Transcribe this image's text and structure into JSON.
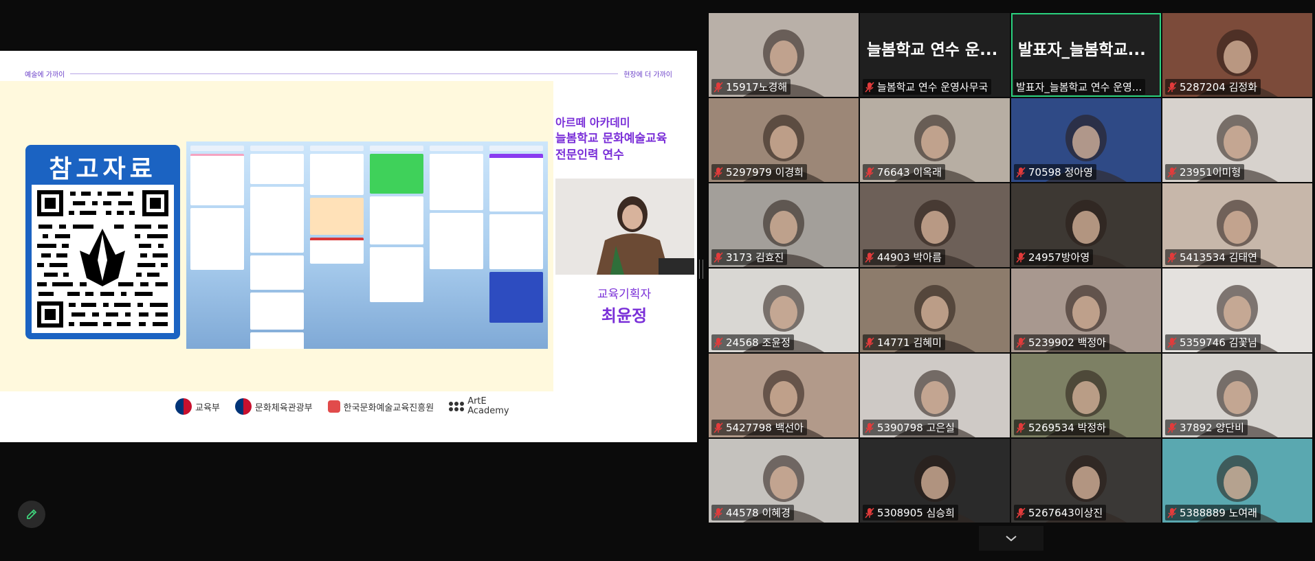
{
  "slide": {
    "top_left": "예술에 가까이",
    "top_right": "현장에 더 가까이",
    "qr_title": "참고자료",
    "sub_title": "아르떼 아카데미",
    "heading_line1": "늘봄학교 문화예술교육",
    "heading_line2": "전문인력 연수",
    "speaker_role": "교육기획자",
    "speaker_name": "최윤정",
    "logos": [
      "교육부",
      "문화체육관광부",
      "한국문화예술교육진흥원",
      "ArtE Academy"
    ]
  },
  "gallery": [
    {
      "name": "15917노경해",
      "bg": "#b9b0a8",
      "muted": true
    },
    {
      "name": "늘봄학교 연수 운영사무국",
      "big": "늘봄학교 연수 운...",
      "bg": "#1f1f1f",
      "muted": true
    },
    {
      "name": "발표자_늘봄학교 연수 운영...",
      "big": "발표자_늘봄학교...",
      "bg": "#1f1f1f",
      "muted": false,
      "active": true
    },
    {
      "name": "5287204 김정화",
      "bg": "#7c4b3a",
      "muted": true
    },
    {
      "name": "5297979 이경희",
      "bg": "#9c8777",
      "muted": true
    },
    {
      "name": "76643 이옥래",
      "bg": "#b7aea3",
      "muted": true
    },
    {
      "name": "70598 정아영",
      "bg": "#2f4a86",
      "muted": true
    },
    {
      "name": "23951이미형",
      "bg": "#d7d2cd",
      "muted": true
    },
    {
      "name": "3173 김효진",
      "bg": "#a39f9a",
      "muted": true
    },
    {
      "name": "44903 박아름",
      "bg": "#6d6058",
      "muted": true
    },
    {
      "name": "24957방아영",
      "bg": "#3d3833",
      "muted": true
    },
    {
      "name": "5413534 김태연",
      "bg": "#c7b7aa",
      "muted": true
    },
    {
      "name": "24568 조윤정",
      "bg": "#d9d7d3",
      "muted": true
    },
    {
      "name": "14771 김혜미",
      "bg": "#8d7c6c",
      "muted": true
    },
    {
      "name": "5239902 백정아",
      "bg": "#a8988f",
      "muted": true
    },
    {
      "name": "5359746 김꽃님",
      "bg": "#e4e1de",
      "muted": true
    },
    {
      "name": "5427798 백선아",
      "bg": "#b29a8a",
      "muted": true
    },
    {
      "name": "5390798 고은실",
      "bg": "#cfcac6",
      "muted": true
    },
    {
      "name": "5269534 박정하",
      "bg": "#7d8064",
      "muted": true
    },
    {
      "name": "37892 양단비",
      "bg": "#d6d3cf",
      "muted": true
    },
    {
      "name": "44578 이혜경",
      "bg": "#c5c2be",
      "muted": true
    },
    {
      "name": "5308905 심승희",
      "bg": "#2a2a2a",
      "muted": true
    },
    {
      "name": "5267643이상진",
      "bg": "#3a3836",
      "muted": true
    },
    {
      "name": "5388889 노여래",
      "bg": "#5aa8b0",
      "muted": true
    }
  ]
}
